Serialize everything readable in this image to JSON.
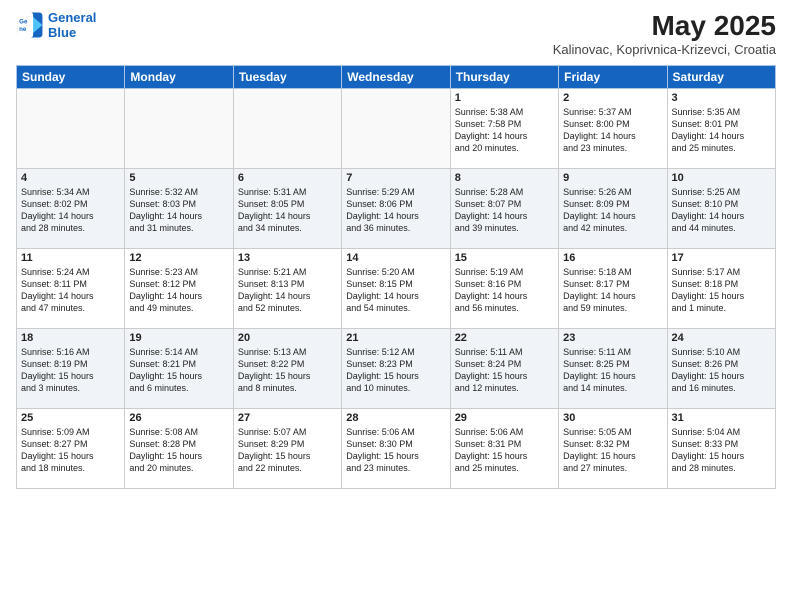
{
  "header": {
    "logo_line1": "General",
    "logo_line2": "Blue",
    "month_year": "May 2025",
    "location": "Kalinovac, Koprivnica-Krizevci, Croatia"
  },
  "weekdays": [
    "Sunday",
    "Monday",
    "Tuesday",
    "Wednesday",
    "Thursday",
    "Friday",
    "Saturday"
  ],
  "weeks": [
    [
      {
        "day": "",
        "text": ""
      },
      {
        "day": "",
        "text": ""
      },
      {
        "day": "",
        "text": ""
      },
      {
        "day": "",
        "text": ""
      },
      {
        "day": "1",
        "text": "Sunrise: 5:38 AM\nSunset: 7:58 PM\nDaylight: 14 hours\nand 20 minutes."
      },
      {
        "day": "2",
        "text": "Sunrise: 5:37 AM\nSunset: 8:00 PM\nDaylight: 14 hours\nand 23 minutes."
      },
      {
        "day": "3",
        "text": "Sunrise: 5:35 AM\nSunset: 8:01 PM\nDaylight: 14 hours\nand 25 minutes."
      }
    ],
    [
      {
        "day": "4",
        "text": "Sunrise: 5:34 AM\nSunset: 8:02 PM\nDaylight: 14 hours\nand 28 minutes."
      },
      {
        "day": "5",
        "text": "Sunrise: 5:32 AM\nSunset: 8:03 PM\nDaylight: 14 hours\nand 31 minutes."
      },
      {
        "day": "6",
        "text": "Sunrise: 5:31 AM\nSunset: 8:05 PM\nDaylight: 14 hours\nand 34 minutes."
      },
      {
        "day": "7",
        "text": "Sunrise: 5:29 AM\nSunset: 8:06 PM\nDaylight: 14 hours\nand 36 minutes."
      },
      {
        "day": "8",
        "text": "Sunrise: 5:28 AM\nSunset: 8:07 PM\nDaylight: 14 hours\nand 39 minutes."
      },
      {
        "day": "9",
        "text": "Sunrise: 5:26 AM\nSunset: 8:09 PM\nDaylight: 14 hours\nand 42 minutes."
      },
      {
        "day": "10",
        "text": "Sunrise: 5:25 AM\nSunset: 8:10 PM\nDaylight: 14 hours\nand 44 minutes."
      }
    ],
    [
      {
        "day": "11",
        "text": "Sunrise: 5:24 AM\nSunset: 8:11 PM\nDaylight: 14 hours\nand 47 minutes."
      },
      {
        "day": "12",
        "text": "Sunrise: 5:23 AM\nSunset: 8:12 PM\nDaylight: 14 hours\nand 49 minutes."
      },
      {
        "day": "13",
        "text": "Sunrise: 5:21 AM\nSunset: 8:13 PM\nDaylight: 14 hours\nand 52 minutes."
      },
      {
        "day": "14",
        "text": "Sunrise: 5:20 AM\nSunset: 8:15 PM\nDaylight: 14 hours\nand 54 minutes."
      },
      {
        "day": "15",
        "text": "Sunrise: 5:19 AM\nSunset: 8:16 PM\nDaylight: 14 hours\nand 56 minutes."
      },
      {
        "day": "16",
        "text": "Sunrise: 5:18 AM\nSunset: 8:17 PM\nDaylight: 14 hours\nand 59 minutes."
      },
      {
        "day": "17",
        "text": "Sunrise: 5:17 AM\nSunset: 8:18 PM\nDaylight: 15 hours\nand 1 minute."
      }
    ],
    [
      {
        "day": "18",
        "text": "Sunrise: 5:16 AM\nSunset: 8:19 PM\nDaylight: 15 hours\nand 3 minutes."
      },
      {
        "day": "19",
        "text": "Sunrise: 5:14 AM\nSunset: 8:21 PM\nDaylight: 15 hours\nand 6 minutes."
      },
      {
        "day": "20",
        "text": "Sunrise: 5:13 AM\nSunset: 8:22 PM\nDaylight: 15 hours\nand 8 minutes."
      },
      {
        "day": "21",
        "text": "Sunrise: 5:12 AM\nSunset: 8:23 PM\nDaylight: 15 hours\nand 10 minutes."
      },
      {
        "day": "22",
        "text": "Sunrise: 5:11 AM\nSunset: 8:24 PM\nDaylight: 15 hours\nand 12 minutes."
      },
      {
        "day": "23",
        "text": "Sunrise: 5:11 AM\nSunset: 8:25 PM\nDaylight: 15 hours\nand 14 minutes."
      },
      {
        "day": "24",
        "text": "Sunrise: 5:10 AM\nSunset: 8:26 PM\nDaylight: 15 hours\nand 16 minutes."
      }
    ],
    [
      {
        "day": "25",
        "text": "Sunrise: 5:09 AM\nSunset: 8:27 PM\nDaylight: 15 hours\nand 18 minutes."
      },
      {
        "day": "26",
        "text": "Sunrise: 5:08 AM\nSunset: 8:28 PM\nDaylight: 15 hours\nand 20 minutes."
      },
      {
        "day": "27",
        "text": "Sunrise: 5:07 AM\nSunset: 8:29 PM\nDaylight: 15 hours\nand 22 minutes."
      },
      {
        "day": "28",
        "text": "Sunrise: 5:06 AM\nSunset: 8:30 PM\nDaylight: 15 hours\nand 23 minutes."
      },
      {
        "day": "29",
        "text": "Sunrise: 5:06 AM\nSunset: 8:31 PM\nDaylight: 15 hours\nand 25 minutes."
      },
      {
        "day": "30",
        "text": "Sunrise: 5:05 AM\nSunset: 8:32 PM\nDaylight: 15 hours\nand 27 minutes."
      },
      {
        "day": "31",
        "text": "Sunrise: 5:04 AM\nSunset: 8:33 PM\nDaylight: 15 hours\nand 28 minutes."
      }
    ]
  ]
}
